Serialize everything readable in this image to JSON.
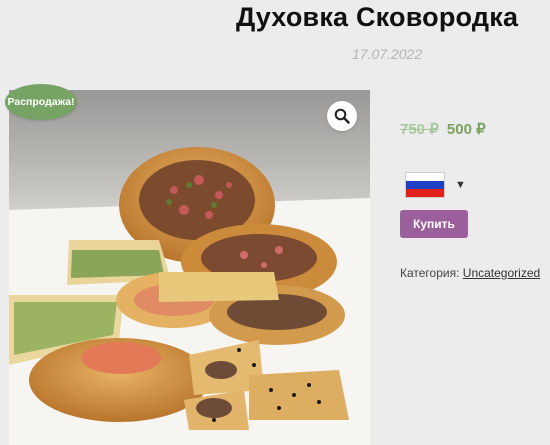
{
  "product": {
    "title": "Духовка Сковородка",
    "date": "17.07.2022",
    "sale_badge": "Распродажа!",
    "price_old": "750 ₽",
    "price_new": "500 ₽",
    "buy_label": "Купить",
    "category_label": "Категория:",
    "category_value": "Uncategorized"
  },
  "currency_selector": {
    "flag": "russia-flag",
    "flag_colors": [
      "#ffffff",
      "#1c3fc4",
      "#e0201b"
    ]
  },
  "icons": {
    "zoom": "search-icon",
    "dropdown": "chevron-down-icon"
  },
  "colors": {
    "sale_badge": "#77a464",
    "price_new": "#7aa25f",
    "price_old": "#a8c89e",
    "buy_button": "#9b5f9c"
  }
}
